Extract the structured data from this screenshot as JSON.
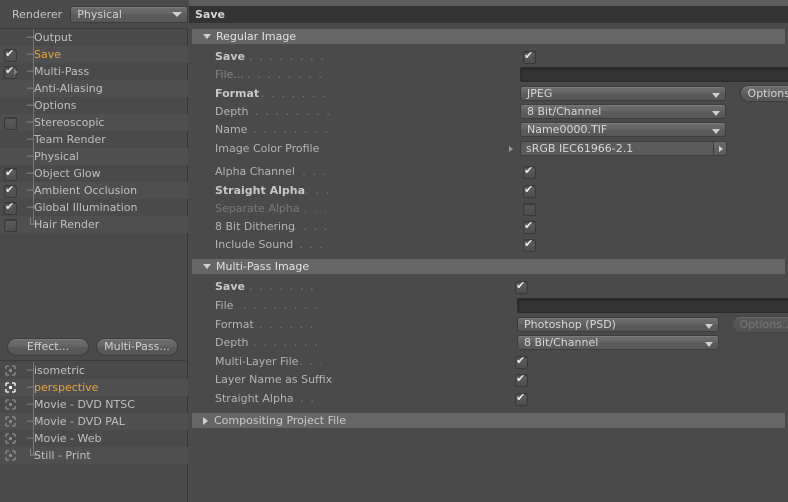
{
  "left_panel": {
    "renderer": {
      "label": "Renderer",
      "value": "Physical"
    },
    "tree_items": [
      {
        "label": "Output",
        "checkbox": "none",
        "selected": false,
        "expander": false
      },
      {
        "label": "Save",
        "checkbox": "checked",
        "selected": true,
        "expander": false
      },
      {
        "label": "Multi-Pass",
        "checkbox": "checked",
        "selected": false,
        "expander": true
      },
      {
        "label": "Anti-Aliasing",
        "checkbox": "none",
        "selected": false,
        "expander": false
      },
      {
        "label": "Options",
        "checkbox": "none",
        "selected": false,
        "expander": false
      },
      {
        "label": "Stereoscopic",
        "checkbox": "unchecked",
        "selected": false,
        "expander": false
      },
      {
        "label": "Team Render",
        "checkbox": "none",
        "selected": false,
        "expander": false
      },
      {
        "label": "Physical",
        "checkbox": "none",
        "selected": false,
        "expander": false
      },
      {
        "label": "Object Glow",
        "checkbox": "checked",
        "selected": false,
        "expander": false
      },
      {
        "label": "Ambient Occlusion",
        "checkbox": "checked",
        "selected": false,
        "expander": false
      },
      {
        "label": "Global Illumination",
        "checkbox": "checked",
        "selected": false,
        "expander": false
      },
      {
        "label": "Hair Render",
        "checkbox": "unchecked",
        "selected": false,
        "expander": false
      }
    ],
    "buttons": {
      "effect": "Effect...",
      "multipass": "Multi-Pass..."
    },
    "presets": [
      {
        "label": "isometric",
        "selected": false
      },
      {
        "label": "perspective",
        "selected": true
      },
      {
        "label": "Movie - DVD NTSC",
        "selected": false
      },
      {
        "label": "Movie - DVD PAL",
        "selected": false
      },
      {
        "label": "Movie - Web",
        "selected": false
      },
      {
        "label": "Still - Print",
        "selected": false
      }
    ]
  },
  "right_panel": {
    "title": "Save",
    "regular_image": {
      "group_title": "Regular Image",
      "expanded": true,
      "save": {
        "label": "Save",
        "value": "checked"
      },
      "file": {
        "label": "File...",
        "value": ""
      },
      "format": {
        "label": "Format",
        "value": "JPEG"
      },
      "depth": {
        "label": "Depth",
        "value": "8 Bit/Channel"
      },
      "name": {
        "label": "Name",
        "value": "Name0000.TIF"
      },
      "color_profile": {
        "label": "Image Color Profile",
        "value": "sRGB IEC61966-2.1"
      },
      "alpha_channel": {
        "label": "Alpha Channel",
        "value": "checked"
      },
      "straight_alpha": {
        "label": "Straight Alpha",
        "value": "checked"
      },
      "separate_alpha": {
        "label": "Separate Alpha",
        "value": "unchecked"
      },
      "dithering": {
        "label": "8 Bit Dithering",
        "value": "checked"
      },
      "include_sound": {
        "label": "Include Sound",
        "value": "checked"
      },
      "options_button": "Options...",
      "browse_button": "..."
    },
    "multipass_image": {
      "group_title": "Multi-Pass Image",
      "expanded": true,
      "save": {
        "label": "Save",
        "value": "checked"
      },
      "file": {
        "label": "File",
        "value": ""
      },
      "format": {
        "label": "Format",
        "value": "Photoshop (PSD)"
      },
      "depth": {
        "label": "Depth",
        "value": "8 Bit/Channel"
      },
      "multi_layer": {
        "label": "Multi-Layer File",
        "value": "checked"
      },
      "layer_suffix": {
        "label": "Layer Name as Suffix",
        "value": "checked"
      },
      "straight_alpha": {
        "label": "Straight Alpha",
        "value": "checked"
      },
      "options_button": "Options...",
      "browse_button": "..."
    },
    "compositing": {
      "group_title": "Compositing Project File",
      "expanded": false
    }
  },
  "colors": {
    "panel_bg": "#4a4a4a",
    "group_bar": "#666666",
    "title_bar": "#333333",
    "selected_text": "#e8a33d",
    "label_text": "#b4b4b4"
  }
}
